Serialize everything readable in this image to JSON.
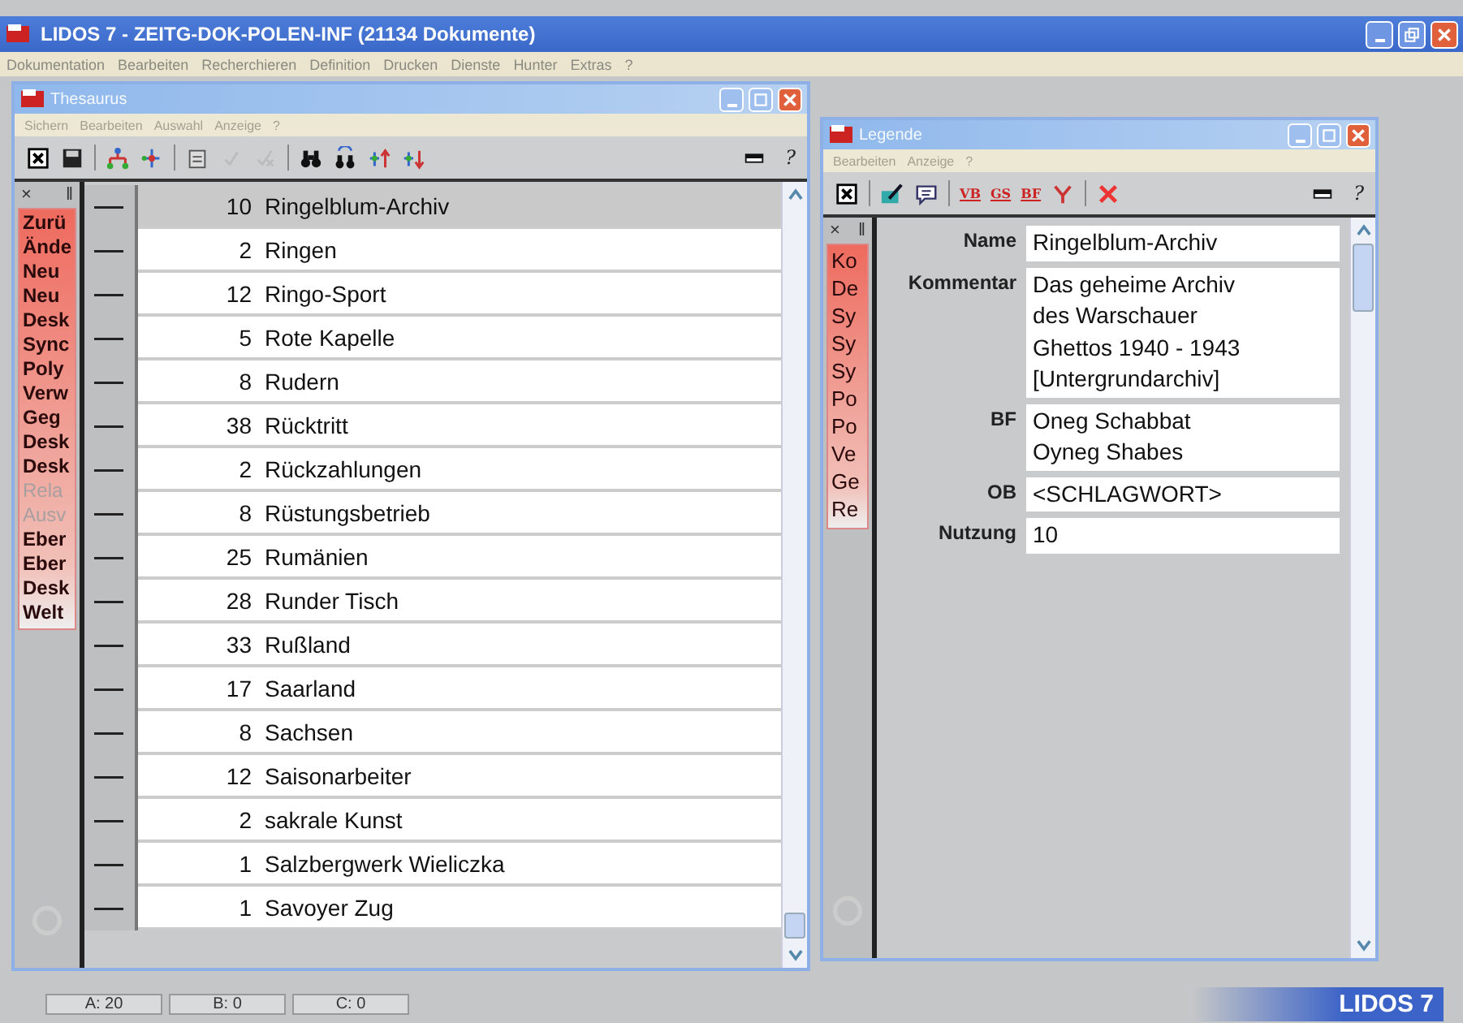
{
  "window": {
    "title": "LIDOS 7 - ZEITG-DOK-POLEN-INF (21134 Dokumente)"
  },
  "menu": [
    "Dokumentation",
    "Bearbeiten",
    "Recherchieren",
    "Definition",
    "Drucken",
    "Dienste",
    "Hunter",
    "Extras",
    "?"
  ],
  "thesaurus": {
    "title": "Thesaurus",
    "menu": [
      "Sichern",
      "Bearbeiten",
      "Auswahl",
      "Anzeige",
      "?"
    ],
    "help": "?",
    "side_panel": {
      "close": "×",
      "pin": "‖",
      "items": [
        {
          "label": "Zurü",
          "disabled": false
        },
        {
          "label": "Ände",
          "disabled": false
        },
        {
          "label": "Neu",
          "disabled": false
        },
        {
          "label": "Neu",
          "disabled": false
        },
        {
          "label": "Desk",
          "disabled": false
        },
        {
          "label": "Sync",
          "disabled": false
        },
        {
          "label": "Poly",
          "disabled": false
        },
        {
          "label": "Verw",
          "disabled": false
        },
        {
          "label": "Geg",
          "disabled": false
        },
        {
          "label": "Desk",
          "disabled": false
        },
        {
          "label": "Desk",
          "disabled": false
        },
        {
          "label": "Rela",
          "disabled": true
        },
        {
          "label": "Ausv",
          "disabled": true
        },
        {
          "label": "Eber",
          "disabled": false
        },
        {
          "label": "Eber",
          "disabled": false
        },
        {
          "label": "Desk",
          "disabled": false
        },
        {
          "label": "Welt",
          "disabled": false
        }
      ]
    },
    "rows": [
      {
        "count": "10",
        "term": "Ringelblum-Archiv",
        "selected": true
      },
      {
        "count": "2",
        "term": "Ringen",
        "selected": false
      },
      {
        "count": "12",
        "term": "Ringo-Sport",
        "selected": false
      },
      {
        "count": "5",
        "term": "Rote Kapelle",
        "selected": false
      },
      {
        "count": "8",
        "term": "Rudern",
        "selected": false
      },
      {
        "count": "38",
        "term": "Rücktritt",
        "selected": false
      },
      {
        "count": "2",
        "term": "Rückzahlungen",
        "selected": false
      },
      {
        "count": "8",
        "term": "Rüstungsbetrieb",
        "selected": false
      },
      {
        "count": "25",
        "term": "Rumänien",
        "selected": false
      },
      {
        "count": "28",
        "term": "Runder Tisch",
        "selected": false
      },
      {
        "count": "33",
        "term": "Rußland",
        "selected": false
      },
      {
        "count": "17",
        "term": "Saarland",
        "selected": false
      },
      {
        "count": "8",
        "term": "Sachsen",
        "selected": false
      },
      {
        "count": "12",
        "term": "Saisonarbeiter",
        "selected": false
      },
      {
        "count": "2",
        "term": "sakrale Kunst",
        "selected": false
      },
      {
        "count": "1",
        "term": "Salzbergwerk Wieliczka",
        "selected": false
      },
      {
        "count": "1",
        "term": "Savoyer Zug",
        "selected": false
      }
    ]
  },
  "legende": {
    "title": "Legende",
    "menu": [
      "Bearbeiten",
      "Anzeige",
      "?"
    ],
    "help": "?",
    "toolbar_labels": [
      "VB",
      "GS",
      "BF"
    ],
    "side_panel": {
      "close": "×",
      "pin": "‖",
      "items": [
        {
          "label": "Ko",
          "disabled": false
        },
        {
          "label": "De",
          "disabled": false
        },
        {
          "label": "Sy",
          "disabled": false
        },
        {
          "label": "Sy",
          "disabled": false
        },
        {
          "label": "Sy",
          "disabled": false
        },
        {
          "label": "Po",
          "disabled": false
        },
        {
          "label": "Po",
          "disabled": false
        },
        {
          "label": "Ve",
          "disabled": false
        },
        {
          "label": "Ge",
          "disabled": false
        },
        {
          "label": "Re",
          "disabled": false
        }
      ]
    },
    "fields": [
      {
        "label": "Name",
        "lines": [
          "Ringelblum-Archiv"
        ]
      },
      {
        "label": "Kommentar",
        "lines": [
          "Das geheime Archiv",
          "des Warschauer",
          "Ghettos 1940 - 1943",
          "[Untergrundarchiv]"
        ]
      },
      {
        "label": "BF",
        "lines": [
          "Oneg Schabbat",
          "Oyneg Shabes"
        ]
      },
      {
        "label": "OB",
        "lines": [
          "<SCHLAGWORT>"
        ]
      },
      {
        "label": "Nutzung",
        "lines": [
          "10"
        ]
      }
    ]
  },
  "status_bar": {
    "panes": [
      "A: 20",
      "B: 0",
      "C: 0"
    ],
    "brand": "LIDOS 7"
  }
}
